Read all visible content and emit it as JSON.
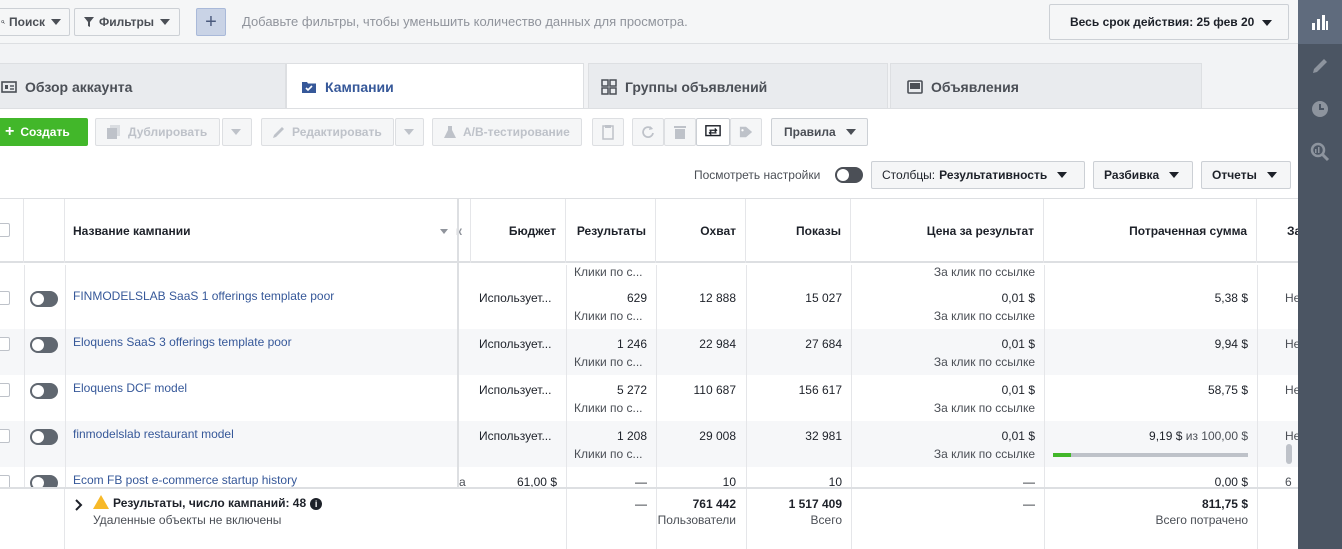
{
  "topbar": {
    "search_label": "Поиск",
    "filters_label": "Фильтры",
    "add_filter_hint": "Добавьте фильтры, чтобы уменьшить количество данных для просмотра.",
    "date_range_label": "Весь срок действия: 25 фев 20"
  },
  "tabs": [
    {
      "label": "Обзор аккаунта"
    },
    {
      "label": "Кампании"
    },
    {
      "label": "Группы объявлений"
    },
    {
      "label": "Объявления"
    }
  ],
  "toolbar": {
    "create_label": "Создать",
    "duplicate_label": "Дублировать",
    "edit_label": "Редактировать",
    "ab_test_label": "A/B-тестирование",
    "rules_label": "Правила"
  },
  "options": {
    "view_settings_label": "Посмотреть настройки",
    "columns_prefix": "Столбцы:",
    "columns_value": "Результативность",
    "breakdown_label": "Разбивка",
    "reports_label": "Отчеты"
  },
  "table": {
    "headers": {
      "name": "Название кампании",
      "partial": "к",
      "budget": "Бюджет",
      "results": "Результаты",
      "reach": "Охват",
      "impressions": "Показы",
      "cost_per_result": "Цена за результат",
      "amount_spent": "Потраченная сумма",
      "next": "За"
    },
    "top_partial": {
      "results_sub": "Клики по с...",
      "cost_sub": "За клик по ссылке"
    },
    "rows": [
      {
        "name": "FINMODELSLAB SaaS 1 offerings template poor",
        "partial": "",
        "budget": "Использует...",
        "results": "629",
        "results_sub": "Клики по с...",
        "reach": "12 888",
        "impressions": "15 027",
        "cost": "0,01 $",
        "cost_sub": "За клик по ссылке",
        "spent": "5,38 $",
        "spent_limit": "",
        "next": "Не"
      },
      {
        "name": "Eloquens SaaS 3 offerings template poor",
        "partial": "",
        "budget": "Использует...",
        "results": "1 246",
        "results_sub": "Клики по с...",
        "reach": "22 984",
        "impressions": "27 684",
        "cost": "0,01 $",
        "cost_sub": "За клик по ссылке",
        "spent": "9,94 $",
        "spent_limit": "",
        "next": "Не"
      },
      {
        "name": "Eloquens DCF model",
        "partial": "",
        "budget": "Использует...",
        "results": "5 272",
        "results_sub": "Клики по с...",
        "reach": "110 687",
        "impressions": "156 617",
        "cost": "0,01 $",
        "cost_sub": "За клик по ссылке",
        "spent": "58,75 $",
        "spent_limit": "",
        "next": "Не"
      },
      {
        "name": "finmodelslab restaurant model",
        "partial": "",
        "budget": "Использует...",
        "results": "1 208",
        "results_sub": "Клики по с...",
        "reach": "29 008",
        "impressions": "32 981",
        "cost": "0,01 $",
        "cost_sub": "За клик по ссылке",
        "spent": "9,19 $",
        "spent_limit": "из 100,00 $",
        "spent_progress": 0.09,
        "next": "Не"
      },
      {
        "name": "Ecom FB post e-commerce startup history",
        "partial": "а",
        "budget": "61,00 $",
        "results": "—",
        "results_sub": "",
        "reach": "10",
        "impressions": "10",
        "cost": "—",
        "cost_sub": "",
        "spent": "0,00 $",
        "spent_limit": "",
        "next": "6"
      }
    ],
    "footer": {
      "title": "Результаты, число кампаний: 48",
      "subtitle": "Удаленные объекты не включены",
      "results": "—",
      "reach": "761 442",
      "reach_sub": "Пользователи",
      "impressions": "1 517 409",
      "impressions_sub": "Всего",
      "cost": "—",
      "spent": "811,75 $",
      "spent_sub": "Всего потрачено"
    }
  },
  "colors": {
    "accent": "#365899",
    "create": "#42b72a",
    "warning": "#f7b928"
  }
}
